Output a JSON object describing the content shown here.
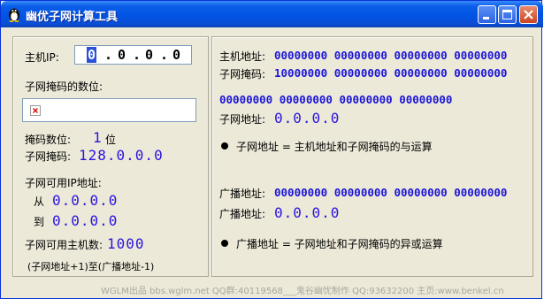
{
  "window": {
    "title": "幽优子网计算工具",
    "title_color": "#0054e3",
    "bg_color": "#ece9d8"
  },
  "host": {
    "label": "主机IP:",
    "octets": [
      "0",
      "0",
      "0",
      "0"
    ],
    "dot": "."
  },
  "mask_bits": {
    "label": "子网掩码的数位:",
    "image_placeholder_icon": "broken-image-icon",
    "count_label": "掩码数位:",
    "count_value": "1",
    "count_unit": "位",
    "mask_label": "子网掩码:",
    "mask_value": "128.0.0.0"
  },
  "usable_ip": {
    "label": "子网可用IP地址:",
    "from_label": "从",
    "from_value": "0.0.0.0",
    "to_label": "到",
    "to_value": "0.0.0.0",
    "hosts_label": "子网可用主机数:",
    "hosts_value": "1000",
    "range_note": "(子网地址+1)至(广播地址-1)"
  },
  "binary": {
    "host_label": "主机地址:",
    "host_bits": "00000000  00000000  00000000  00000000",
    "mask_label": "子网掩码:",
    "mask_bits": "10000000  00000000  00000000  00000000",
    "subnet_bits": "00000000  00000000  00000000  00000000",
    "subnet_label": "子网地址:",
    "subnet_value": "0.0.0.0",
    "subnet_note": "子网地址 = 主机地址和子网掩码的与运算",
    "bcast_label": "广播地址:",
    "bcast_bits": "00000000  00000000  00000000  00000000",
    "bcast_value_label": "广播地址:",
    "bcast_value": "0.0.0.0",
    "bcast_note": "广播地址 = 子网地址和子网掩码的异或运算"
  },
  "status": {
    "text": "WGLM出品 bbs.wglm.net QQ群:40119568___鬼谷幽忧制作 QQ:93632200 主页:www.benkel.cn"
  },
  "colors": {
    "value_blue": "#2b13e0",
    "bits_blue": "#1a14d9"
  }
}
